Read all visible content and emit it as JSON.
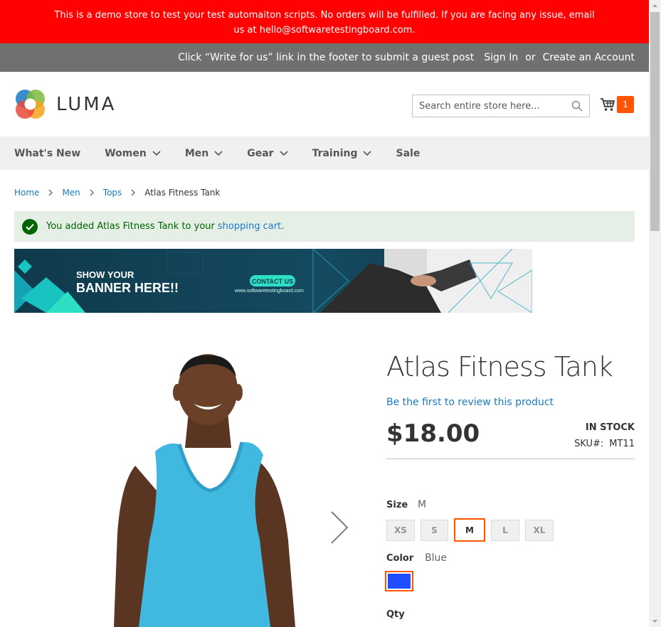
{
  "notice": {
    "text": "This is a demo store to test your test automaiton scripts. No orders will be fulfilled. If you are facing any issue, email us at hello@softwaretestingboard.com."
  },
  "header_links": {
    "guest_post": "Click “Write for us” link in the footer to submit a guest post",
    "sign_in": "Sign In",
    "or": "or",
    "create_account": "Create an Account"
  },
  "logo": {
    "text": "LUMA"
  },
  "search": {
    "placeholder": "Search entire store here..."
  },
  "cart": {
    "count": "1"
  },
  "nav": {
    "items": [
      {
        "label": "What's New"
      },
      {
        "label": "Women"
      },
      {
        "label": "Men"
      },
      {
        "label": "Gear"
      },
      {
        "label": "Training"
      },
      {
        "label": "Sale"
      }
    ]
  },
  "breadcrumb": {
    "items": [
      "Home",
      "Men",
      "Tops"
    ],
    "current": "Atlas Fitness Tank"
  },
  "message": {
    "prefix": "You added Atlas Fitness Tank to your",
    "link": "shopping cart",
    "suffix": "."
  },
  "banner": {
    "line1": "SHOW YOUR",
    "line2": "BANNER HERE!!",
    "cta": "CONTACT US",
    "url": "www.softwaretestingboard.com"
  },
  "product": {
    "title": "Atlas Fitness Tank",
    "review_link": "Be the first to review this product",
    "price": "$18.00",
    "stock": "IN STOCK",
    "sku_label": "SKU#:",
    "sku": "MT11"
  },
  "options": {
    "size_label": "Size",
    "size_selected": "M",
    "sizes": [
      "XS",
      "S",
      "M",
      "L",
      "XL"
    ],
    "color_label": "Color",
    "color_selected": "Blue",
    "swatch_color": "#1f4dff",
    "qty_label": "Qty"
  },
  "colors": {
    "notice_bg": "#ff0101",
    "header_links_bg": "#6e716e",
    "accent": "#ff5501",
    "link": "#1979c3",
    "success_bg": "#e5efe5",
    "success_text": "#006400"
  }
}
